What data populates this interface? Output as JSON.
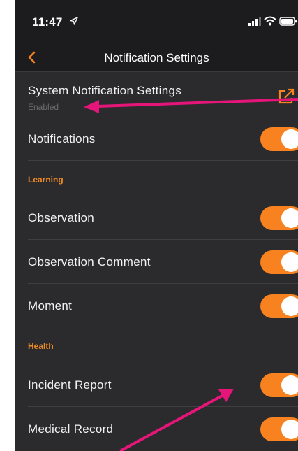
{
  "status_bar": {
    "time": "11:47"
  },
  "nav": {
    "title": "Notification Settings"
  },
  "system_settings": {
    "label": "System Notification Settings",
    "status": "Enabled"
  },
  "notifications": {
    "label": "Notifications",
    "enabled": true
  },
  "sections": {
    "learning": {
      "header": "Learning",
      "items": [
        {
          "label": "Observation",
          "enabled": true
        },
        {
          "label": "Observation Comment",
          "enabled": true
        },
        {
          "label": "Moment",
          "enabled": true
        }
      ]
    },
    "health": {
      "header": "Health",
      "items": [
        {
          "label": "Incident Report",
          "enabled": true
        },
        {
          "label": "Medical Record",
          "enabled": true
        }
      ]
    }
  },
  "colors": {
    "accent": "#f7821f",
    "background": "#2b2b2d",
    "bar": "#1c1c1e",
    "annotation_arrow": "#e6157a"
  }
}
